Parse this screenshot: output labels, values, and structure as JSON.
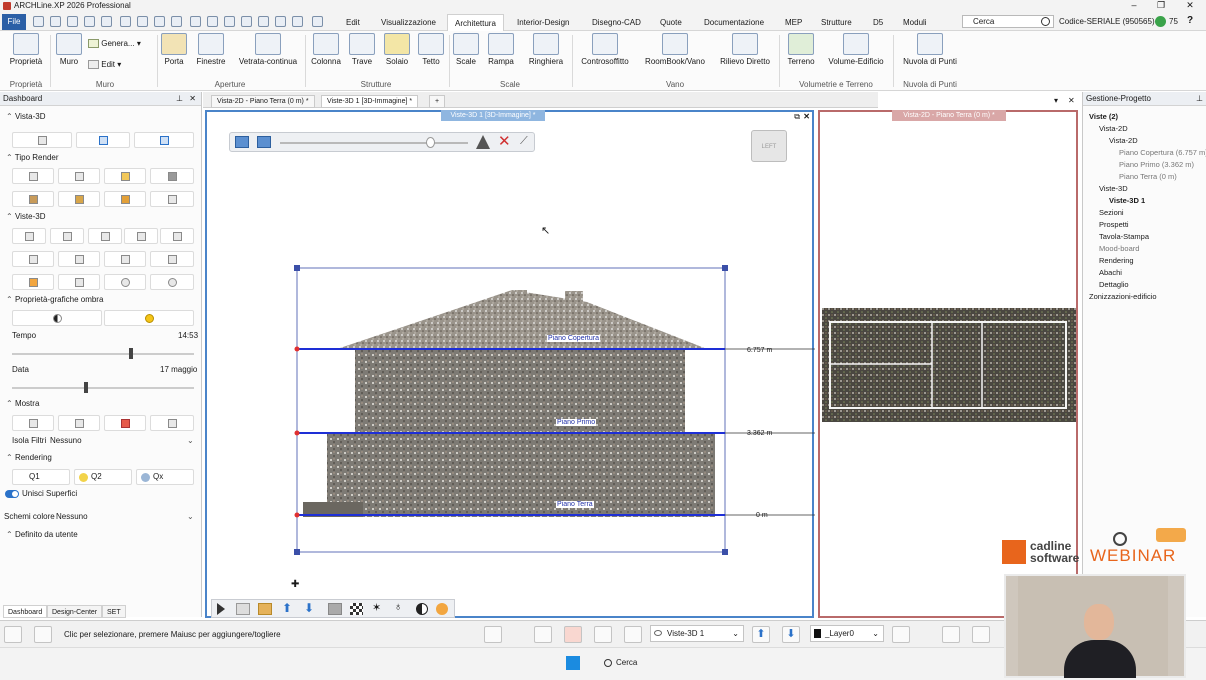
{
  "app": {
    "title": "ARCHLine.XP 2026 Professional"
  },
  "menu": {
    "file": "File",
    "items": [
      "Edit",
      "Visualizzazione",
      "Architettura",
      "Interior-Design",
      "Disegno-CAD",
      "Quote",
      "Documentazione",
      "MEP",
      "Strutture",
      "D5",
      "Moduli"
    ],
    "active": "Architettura",
    "search_placeholder": "Cerca",
    "serial": "Codice-SERIALE (950565)",
    "badge": "75",
    "help": "?"
  },
  "ribbon": {
    "buttons": [
      "Proprietà",
      "Muro",
      "Genera...",
      "Edit",
      "Porta",
      "Finestre",
      "Vetrata-continua",
      "Colonna",
      "Trave",
      "Solaio",
      "Tetto",
      "Scale",
      "Rampa",
      "Ringhiera",
      "Controsoffitto",
      "RoomBook/Vano",
      "Rilievo Diretto",
      "Terreno",
      "Volume-Edificio",
      "Nuvola di Punti"
    ],
    "groups": [
      "Proprietà",
      "Muro",
      "Aperture",
      "Strutture",
      "Scale",
      "Vano",
      "Volumetrie e Terreno",
      "Nuvola di Punti"
    ]
  },
  "dashboard": {
    "title": "Dashboard",
    "sections": [
      "Vista-3D",
      "Tipo Render",
      "Viste-3D",
      "Proprietà-grafiche ombra",
      "Mostra",
      "Rendering",
      "Definito da utente"
    ],
    "tempo_label": "Tempo",
    "tempo_value": "14:53",
    "tempo_pos": 0.65,
    "data_label": "Data",
    "data_value": "17 maggio",
    "data_pos": 0.4,
    "isola_label": "Isola Filtri",
    "isola_value": "Nessuno",
    "quality": [
      "Q1",
      "Q2",
      "Qx"
    ],
    "unisci": "Unisci Superfici",
    "schemi_label": "Schemi colore",
    "schemi_value": "Nessuno",
    "tabs": [
      "Dashboard",
      "Design-Center",
      "SET"
    ]
  },
  "doc_tabs": [
    "Vista-2D - Piano Terra (0 m) *",
    "Viste-3D 1 [3D-Immagine] *",
    "+"
  ],
  "view3d": {
    "title": "Viste-3D 1 [3D-Immagine] *",
    "cube_label": "LEFT",
    "levels": [
      {
        "name": "Piano Copertura",
        "height": "6.757 m"
      },
      {
        "name": "Piano Primo",
        "height": "3.362 m"
      },
      {
        "name": "Piano Terra",
        "height": "0 m"
      }
    ]
  },
  "view2d": {
    "title": "Vista-2D - Piano Terra (0 m) *"
  },
  "tree": {
    "title": "Gestione-Progetto",
    "items": [
      {
        "label": "Viste (2)",
        "indent": 0,
        "bold": true
      },
      {
        "label": "Vista-2D",
        "indent": 1
      },
      {
        "label": "Vista-2D",
        "indent": 2
      },
      {
        "label": "Piano Copertura (6.757 m)",
        "indent": 3,
        "gray": true
      },
      {
        "label": "Piano Primo (3.362 m)",
        "indent": 3,
        "gray": true
      },
      {
        "label": "Piano Terra (0 m)",
        "indent": 3,
        "gray": true
      },
      {
        "label": "Viste-3D",
        "indent": 1
      },
      {
        "label": "Viste-3D 1",
        "indent": 2,
        "bold": true
      },
      {
        "label": "Sezioni",
        "indent": 1
      },
      {
        "label": "Prospetti",
        "indent": 1
      },
      {
        "label": "Tavola-Stampa",
        "indent": 1
      },
      {
        "label": "Mood-board",
        "indent": 1,
        "gray": true
      },
      {
        "label": "Rendering",
        "indent": 1
      },
      {
        "label": "Abachi",
        "indent": 1
      },
      {
        "label": "Dettaglio",
        "indent": 1
      },
      {
        "label": "Zonizzazioni-edificio",
        "indent": 0
      }
    ]
  },
  "status": {
    "hint": "Clic per selezionare, premere Maiusc per aggiungere/togliere",
    "view_select": "Viste-3D 1",
    "layer": "_Layer0"
  },
  "taskbar": {
    "search": "Cerca"
  },
  "branding": {
    "cadline_1": "cadline",
    "cadline_2": "software",
    "webinar": "WEBINAR"
  }
}
